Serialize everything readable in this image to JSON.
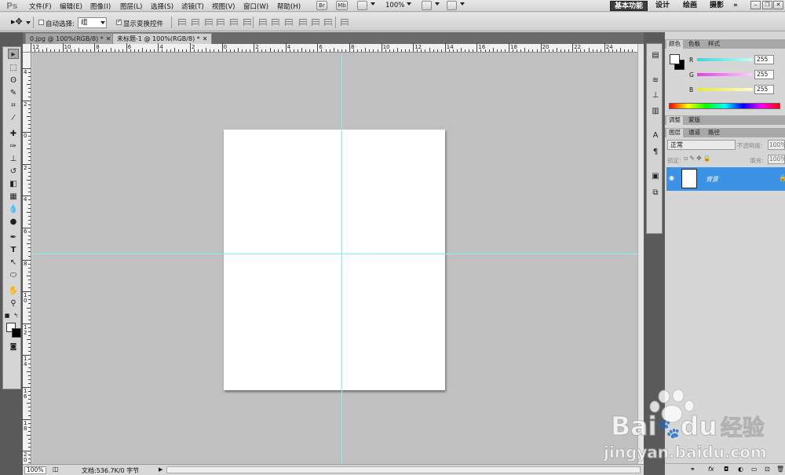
{
  "menubar": {
    "app_logo": "Ps",
    "items": [
      "文件(F)",
      "编辑(E)",
      "图像(I)",
      "图层(L)",
      "选择(S)",
      "滤镜(T)",
      "视图(V)",
      "窗口(W)",
      "帮助(H)"
    ],
    "bridge_label": "Br",
    "minibridge_label": "Mb",
    "zoom": "100%",
    "workspaces": [
      "基本功能",
      "设计",
      "绘画",
      "摄影"
    ],
    "more": "»"
  },
  "options": {
    "auto_select_label": "自动选择:",
    "auto_select_value": "组",
    "show_transform_label": "显示变换控件",
    "show_transform_checked": true
  },
  "tabs": [
    {
      "label": "0.jpg @ 100%(RGB/8) *"
    },
    {
      "label": "未标题-1 @ 100%(RGB/8) *"
    }
  ],
  "ruler_top": [
    "12",
    "10",
    "8",
    "6",
    "4",
    "2",
    "0",
    "2",
    "4",
    "6",
    "8",
    "10",
    "12",
    "14",
    "16",
    "18",
    "20",
    "22",
    "24"
  ],
  "ruler_left": [
    "4",
    "2",
    "0",
    "2",
    "4",
    "6",
    "8",
    "1\n0",
    "1\n2",
    "1\n4",
    "1\n6",
    "1\n8",
    "2\n0"
  ],
  "statusbar": {
    "zoom": "100%",
    "doc_info": "文档:536.7K/0 字节"
  },
  "color_panel": {
    "tabs": [
      "颜色",
      "色板",
      "样式"
    ],
    "channels": [
      {
        "label": "R",
        "value": "255",
        "color": "#3fd6d6"
      },
      {
        "label": "G",
        "value": "255",
        "color": "#e63ee6"
      },
      {
        "label": "B",
        "value": "255",
        "color": "#e6e63e"
      }
    ]
  },
  "adjust_panel": {
    "tabs": [
      "调整",
      "蒙版"
    ]
  },
  "layers_panel": {
    "tabs": [
      "图层",
      "通道",
      "路径"
    ],
    "blend_mode": "正常",
    "opacity_label": "不透明度:",
    "opacity_value": "100%",
    "lock_label": "锁定:",
    "fill_label": "填充:",
    "fill_value": "100%",
    "layers": [
      {
        "name": "背景",
        "selected": true
      }
    ]
  },
  "watermark": {
    "brand_1": "Bai",
    "brand_2": "du",
    "brand_cn": "经验",
    "url": "jingyan.baidu.com"
  },
  "colors": {
    "guide": "#7ff3f3",
    "selected_layer": "#3c93e6",
    "pasteboard": "#c0c0c0"
  }
}
